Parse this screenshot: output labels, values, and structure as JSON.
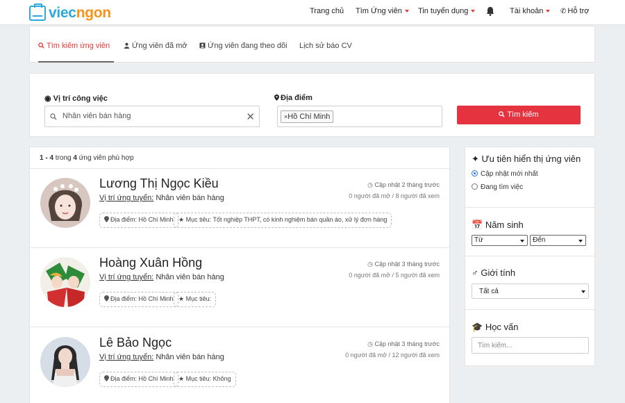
{
  "brand": {
    "part1": "viec",
    "part2": "ngon",
    "color1": "#29a9e0",
    "color2": "#f7931d"
  },
  "nav": {
    "home": "Trang chủ",
    "find": "Tìm Ứng viên",
    "jobs": "Tin tuyển dụng",
    "account": "Tài khoản",
    "support": "Hỗ trợ"
  },
  "tabs": [
    {
      "label": "Tìm kiếm ứng viên",
      "icon": "search-icon",
      "active": true
    },
    {
      "label": "Ứng viên đã mở",
      "icon": "user-icon",
      "active": false
    },
    {
      "label": "Ứng viên đang theo dõi",
      "icon": "contact-card-icon",
      "active": false
    },
    {
      "label": "Lịch sử báo CV",
      "icon": "",
      "active": false
    }
  ],
  "search": {
    "position_label": "Vị trí công việc",
    "position_value": "Nhân viên bán hàng",
    "location_label": "Địa điểm",
    "location_tag": "Hồ Chí Minh",
    "button": "Tìm kiếm",
    "button_color": "#e53340"
  },
  "results": {
    "range": "1 - 4",
    "word_in": "trong",
    "total": "4",
    "suffix": "ứng viên phù hợp",
    "position_prefix": "Vị trí ứng tuyển:",
    "candidates": [
      {
        "name": "Lương Thị Ngọc Kiều",
        "position": "Nhân viên bán hàng",
        "updated": "Cập nhật 2 tháng trước",
        "views": "0 người đã mở / 8 người đã xem",
        "location": "Địa điểm: Hồ Chí Minh",
        "goal": "Mục tiêu: Tốt nghiệp THPT, có kinh nghiệm bán quần áo, xử lý đơn hàng"
      },
      {
        "name": "Hoàng Xuân Hồng",
        "position": "Nhân viên bán hàng",
        "updated": "Cập nhật 3 tháng trước",
        "views": "0 người đã mở / 5 người đã xem",
        "location": "Địa điểm: Hồ Chí Minh",
        "goal": "Mục tiêu:"
      },
      {
        "name": "Lê Bảo Ngọc",
        "position": "Nhân viên bán hàng",
        "updated": "Cập nhật 3 tháng trước",
        "views": "0 người đã mở / 12 người đã xem",
        "location": "Địa điểm: Hồ Chí Minh",
        "goal": "Mục tiêu: Không"
      }
    ]
  },
  "sidebar": {
    "priority_title": "Ưu tiên hiển thị ứng viên",
    "priority_options": [
      {
        "label": "Cập nhật mới nhất",
        "checked": true
      },
      {
        "label": "Đang tìm việc",
        "checked": false
      }
    ],
    "birth_title": "Năm sinh",
    "birth_from": "Từ",
    "birth_to": "Đến",
    "gender_title": "Giới tính",
    "gender_value": "Tất cả",
    "edu_title": "Học vấn",
    "edu_placeholder": "Tìm kiếm..."
  }
}
